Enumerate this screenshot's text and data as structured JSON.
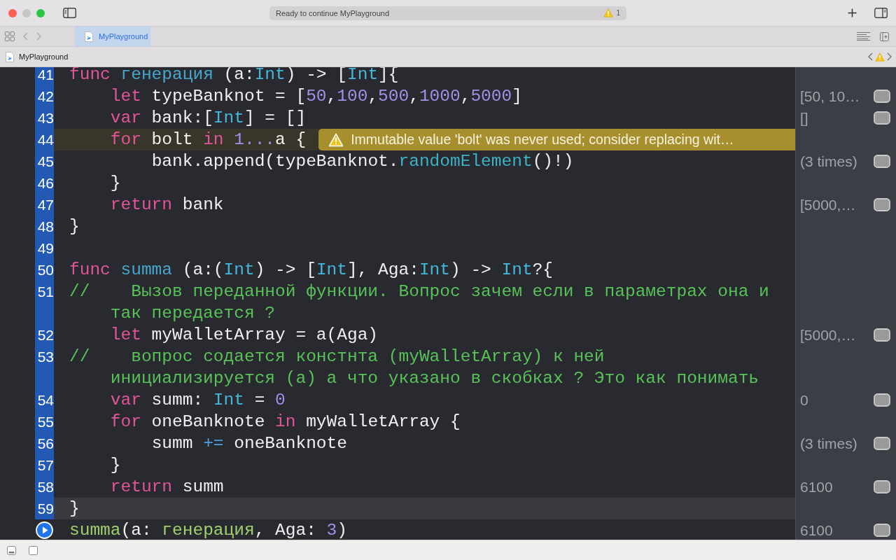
{
  "window": {
    "status_text": "Ready to continue MyPlayground",
    "warning_count": "1"
  },
  "tabs": [
    {
      "label": "MyPlayground",
      "selected": true
    }
  ],
  "jump_bar": {
    "path": [
      "MyPlayground"
    ]
  },
  "editor": {
    "lines": [
      {
        "number": "41",
        "tokens": [
          {
            "kind": "keyword",
            "text": "func "
          },
          {
            "kind": "declaration",
            "text": "генерация"
          },
          {
            "kind": "plain",
            "text": " (a:"
          },
          {
            "kind": "type",
            "text": "Int"
          },
          {
            "kind": "plain",
            "text": ") -> ["
          },
          {
            "kind": "type",
            "text": "Int"
          },
          {
            "kind": "plain",
            "text": "]{"
          }
        ]
      },
      {
        "number": "42",
        "tokens": [
          {
            "kind": "keyword",
            "text": "    let"
          },
          {
            "kind": "plain",
            "text": " typeBanknot = ["
          },
          {
            "kind": "number",
            "text": "50"
          },
          {
            "kind": "plain",
            "text": ","
          },
          {
            "kind": "number",
            "text": "100"
          },
          {
            "kind": "plain",
            "text": ","
          },
          {
            "kind": "number",
            "text": "500"
          },
          {
            "kind": "plain",
            "text": ","
          },
          {
            "kind": "number",
            "text": "1000"
          },
          {
            "kind": "plain",
            "text": ","
          },
          {
            "kind": "number",
            "text": "5000"
          },
          {
            "kind": "plain",
            "text": "]"
          }
        ],
        "result": "[50, 10…"
      },
      {
        "number": "43",
        "tokens": [
          {
            "kind": "keyword",
            "text": "    var"
          },
          {
            "kind": "plain",
            "text": " bank:["
          },
          {
            "kind": "type",
            "text": "Int"
          },
          {
            "kind": "plain",
            "text": "] = []"
          }
        ],
        "result": "[]"
      },
      {
        "number": "44",
        "tokens": [
          {
            "kind": "keyword",
            "text": "    for"
          },
          {
            "kind": "plain",
            "text": " bolt "
          },
          {
            "kind": "keyword",
            "text": "in "
          },
          {
            "kind": "number",
            "text": "1..."
          },
          {
            "kind": "plain",
            "text": "a {"
          }
        ],
        "warning": "Immutable value 'bolt' was never used; consider replacing wit…"
      },
      {
        "number": "45",
        "tokens": [
          {
            "kind": "plain",
            "text": "        bank.append(typeBanknot."
          },
          {
            "kind": "method",
            "text": "randomElement"
          },
          {
            "kind": "plain",
            "text": "()!)"
          }
        ],
        "result": "(3 times)"
      },
      {
        "number": "46",
        "tokens": [
          {
            "kind": "plain",
            "text": "    }"
          }
        ]
      },
      {
        "number": "47",
        "tokens": [
          {
            "kind": "keyword",
            "text": "    return"
          },
          {
            "kind": "plain",
            "text": " bank"
          }
        ],
        "result": "[5000,…"
      },
      {
        "number": "48",
        "tokens": [
          {
            "kind": "plain",
            "text": "}"
          }
        ]
      },
      {
        "number": "49"
      },
      {
        "number": "50",
        "tokens": [
          {
            "kind": "keyword",
            "text": "func "
          },
          {
            "kind": "declaration",
            "text": "summa"
          },
          {
            "kind": "plain",
            "text": " (a:("
          },
          {
            "kind": "type",
            "text": "Int"
          },
          {
            "kind": "plain",
            "text": ") -> ["
          },
          {
            "kind": "type",
            "text": "Int"
          },
          {
            "kind": "plain",
            "text": "], Aga:"
          },
          {
            "kind": "type",
            "text": "Int"
          },
          {
            "kind": "plain",
            "text": ") -> "
          },
          {
            "kind": "type",
            "text": "Int"
          },
          {
            "kind": "plain",
            "text": "?{"
          }
        ]
      },
      {
        "number": "51",
        "tokens": [
          {
            "kind": "comment",
            "text": "//    Вызов переданной функции. Вопрос зачем если в параметрах она и так передается ?"
          }
        ]
      },
      {
        "number": "52",
        "tokens": [
          {
            "kind": "keyword",
            "text": "    let"
          },
          {
            "kind": "plain",
            "text": " myWalletArray = a(Aga)"
          }
        ],
        "result": "[5000,…"
      },
      {
        "number": "53",
        "tokens": [
          {
            "kind": "comment",
            "text": "//    вопрос содается констнта (myWalletArray) к ней инициализируется (а) а что указано в скобках ? Это как понимать"
          }
        ]
      },
      {
        "number": "54",
        "tokens": [
          {
            "kind": "keyword",
            "text": "    var"
          },
          {
            "kind": "plain",
            "text": " summ: "
          },
          {
            "kind": "type",
            "text": "Int"
          },
          {
            "kind": "plain",
            "text": " = "
          },
          {
            "kind": "number",
            "text": "0"
          }
        ],
        "result": "0"
      },
      {
        "number": "55",
        "tokens": [
          {
            "kind": "keyword",
            "text": "    for"
          },
          {
            "kind": "plain",
            "text": " oneBanknote "
          },
          {
            "kind": "keyword",
            "text": "in"
          },
          {
            "kind": "plain",
            "text": " myWalletArray {"
          }
        ]
      },
      {
        "number": "56",
        "tokens": [
          {
            "kind": "plain",
            "text": "        summ "
          },
          {
            "kind": "operator",
            "text": "+="
          },
          {
            "kind": "plain",
            "text": " oneBanknote"
          }
        ],
        "result": "(3 times)"
      },
      {
        "number": "57",
        "tokens": [
          {
            "kind": "plain",
            "text": "    }"
          }
        ]
      },
      {
        "number": "58",
        "tokens": [
          {
            "kind": "keyword",
            "text": "    return"
          },
          {
            "kind": "plain",
            "text": " summ"
          }
        ],
        "result": "6100"
      },
      {
        "number": "59",
        "current": true,
        "tokens": [
          {
            "kind": "plain",
            "text": "}"
          }
        ]
      },
      {
        "run_button": true,
        "tokens": [
          {
            "kind": "call",
            "text": "summa"
          },
          {
            "kind": "plain",
            "text": "(a: "
          },
          {
            "kind": "call",
            "text": "генерация"
          },
          {
            "kind": "plain",
            "text": ", Aga: "
          },
          {
            "kind": "number",
            "text": "3"
          },
          {
            "kind": "plain",
            "text": ")"
          }
        ],
        "result": "6100"
      }
    ]
  }
}
